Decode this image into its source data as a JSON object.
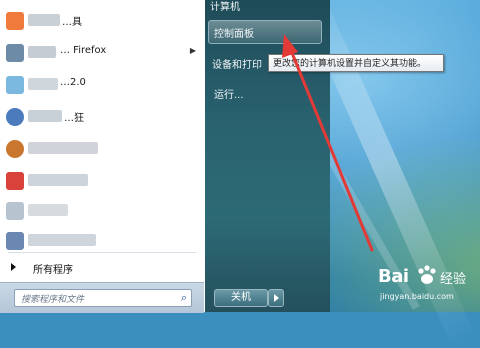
{
  "start_menu": {
    "programs": [
      {
        "label": "…具",
        "icon_color": "#f07a3c",
        "blur_width": 32
      },
      {
        "label": "… Firefox",
        "icon_color": "#6d8aa6",
        "blur_width": 28,
        "has_submenu": true
      },
      {
        "label": "…2.0",
        "icon_color": "#7bb8e0",
        "blur_width": 30
      },
      {
        "label": "…狂",
        "icon_color": "#4b7bbd",
        "blur_width": 34
      },
      {
        "label": "",
        "icon_color": "#c9772e",
        "blur_width": 70
      },
      {
        "label": "",
        "icon_color": "#d8423b",
        "blur_width": 60
      },
      {
        "label": "",
        "icon_color": "#b7c3cf",
        "blur_width": 40
      },
      {
        "label": "",
        "icon_color": "#6b88b2",
        "blur_width": 68
      }
    ],
    "all_programs_label": "所有程序",
    "search_placeholder": "搜索程序和文件",
    "right_items": {
      "computer": "计算机",
      "control_panel": "控制面板",
      "devices_printers": "设备和打印",
      "run": "运行..."
    },
    "shutdown_label": "关机"
  },
  "tooltip": {
    "text": "更改您的计算机设置并自定义其功能。"
  },
  "watermark": {
    "logo_text": "Bai",
    "logo_text2": "经验",
    "url": "jingyan.baidu.com"
  },
  "colors": {
    "arrow": "#e23a36",
    "right_pane": "#2a6270"
  }
}
